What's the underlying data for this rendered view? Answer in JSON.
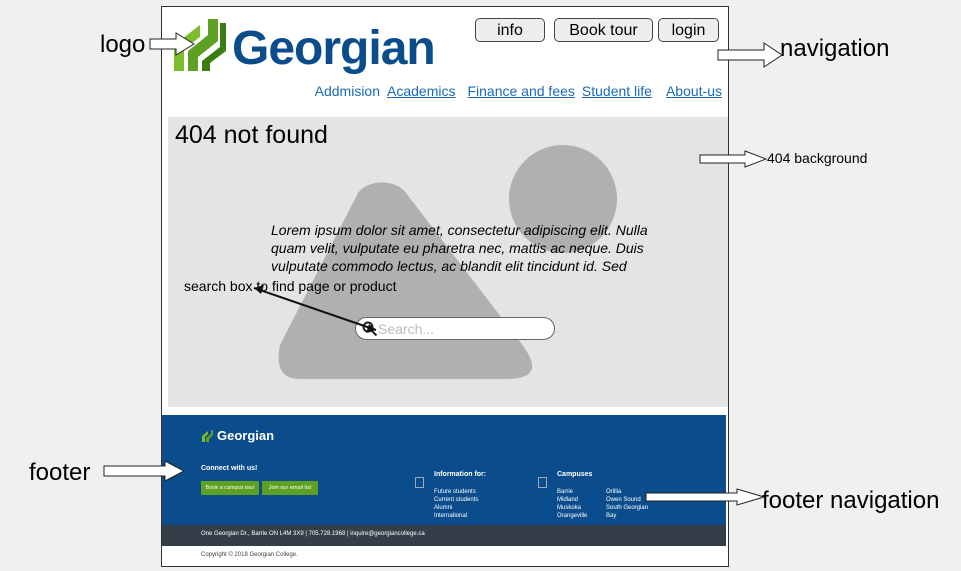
{
  "header": {
    "logo_text": "Georgian",
    "buttons": [
      "info",
      "Book tour",
      "login"
    ],
    "nav": [
      "Addmision",
      "Academics",
      "Finance and fees",
      "Student life",
      "About-us"
    ]
  },
  "hero": {
    "title": "404 not found",
    "text": "Lorem ipsum dolor sit amet, consectetur adipiscing elit. Nulla quam velit, vulputate eu pharetra nec, mattis ac neque. Duis vulputate commodo lectus, ac blandit elit tincidunt id. Sed",
    "search_placeholder": "Search..."
  },
  "footer": {
    "logo_text": "Georgian",
    "connect_title": "Connect with us!",
    "buttons": [
      "Book a campus tour",
      "Join our email list"
    ],
    "info_title": "Information for:",
    "info_items": [
      "Future students",
      "Current students",
      "Alumni",
      "International"
    ],
    "campuses_title": "Campuses",
    "campuses_col1": [
      "Barrie",
      "Midland",
      "Muskoka",
      "Orangeville"
    ],
    "campuses_col2": [
      "Orillia",
      "Owen Sound",
      "South Georgian",
      "Bay"
    ],
    "contact": "One Georgian Dr., Barrie ON L4M 3X9 | 705.728.1968 | inquire@georgiancollege.ca",
    "copyright": "Copyright © 2018 Georgian College."
  },
  "annotations": {
    "logo": "logo",
    "navigation": "navigation",
    "background": "404 background",
    "search": "search box to find page or product",
    "footer": "footer",
    "footer_nav": "footer navigation"
  },
  "colors": {
    "brand_blue": "#0b4d8c",
    "brand_green": "#5da024",
    "link_blue": "#1a6ab5",
    "footer_bar": "#333e48"
  }
}
